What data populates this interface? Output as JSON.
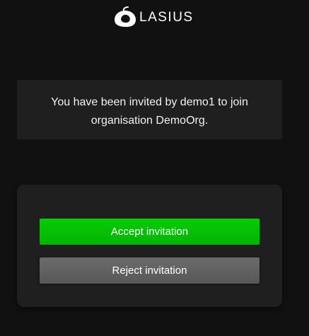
{
  "header": {
    "logo_icon": "lasius-logo-icon",
    "logo_text": "LASIUS"
  },
  "invitation": {
    "line1": "You have been invited by demo1 to join",
    "line2": "organisation DemoOrg."
  },
  "actions": {
    "accept_label": "Accept invitation",
    "reject_label": "Reject invitation"
  },
  "colors": {
    "background": "#111111",
    "card": "#1f1f1f",
    "accept": "#05c005",
    "reject": "#616161"
  }
}
